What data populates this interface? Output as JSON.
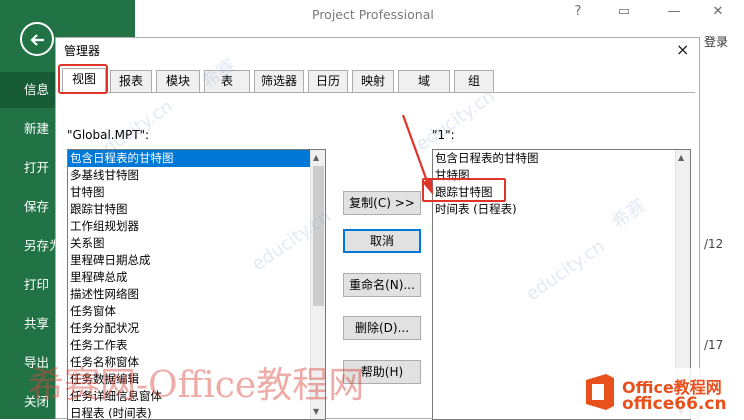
{
  "app": {
    "title": "Project Professional",
    "help_glyph": "?",
    "ribbon_glyph": "▭",
    "min_glyph": "—",
    "close_glyph": "✕",
    "login": "登录",
    "side_dates": [
      "/12",
      "/17"
    ]
  },
  "sidebar": {
    "items": [
      "信息",
      "新建",
      "打开",
      "保存",
      "另存为",
      "打印",
      "共享",
      "导出",
      "关闭"
    ],
    "active_index": 0
  },
  "dialog": {
    "title": "管理器",
    "close": "×",
    "tabs": [
      "视图",
      "报表",
      "模块",
      "表",
      "筛选器",
      "日历",
      "映射",
      "域",
      "组"
    ],
    "active_tab": 0,
    "left_label": "\"Global.MPT\":",
    "right_label": "\"1\":",
    "left_items": [
      "包含日程表的甘特图",
      "多基线甘特图",
      "甘特图",
      "跟踪甘特图",
      "工作组规划器",
      "关系图",
      "里程碑日期总成",
      "里程碑总成",
      "描述性网络图",
      "任务窗体",
      "任务分配状况",
      "任务工作表",
      "任务名称窗体",
      "任务数据编辑",
      "任务详细信息窗体",
      "日程表 (时间表)"
    ],
    "right_items": [
      "包含日程表的甘特图",
      "甘特图",
      "跟踪甘特图",
      "时间表 (日程表)"
    ],
    "buttons": {
      "copy": "复制(C) >>",
      "cancel": "取消",
      "rename": "重命名(N)...",
      "delete": "删除(D)...",
      "help": "帮助(H)"
    }
  },
  "watermark": {
    "text": "educity.cn",
    "brand": "希赛",
    "bottom": "希赛网-Office教程网"
  },
  "logo": {
    "line1": "Office教程网",
    "line2": "office66.cn"
  },
  "colors": {
    "sidebar": "#217346",
    "selection": "#0078d7",
    "highlight": "#e0342a"
  }
}
